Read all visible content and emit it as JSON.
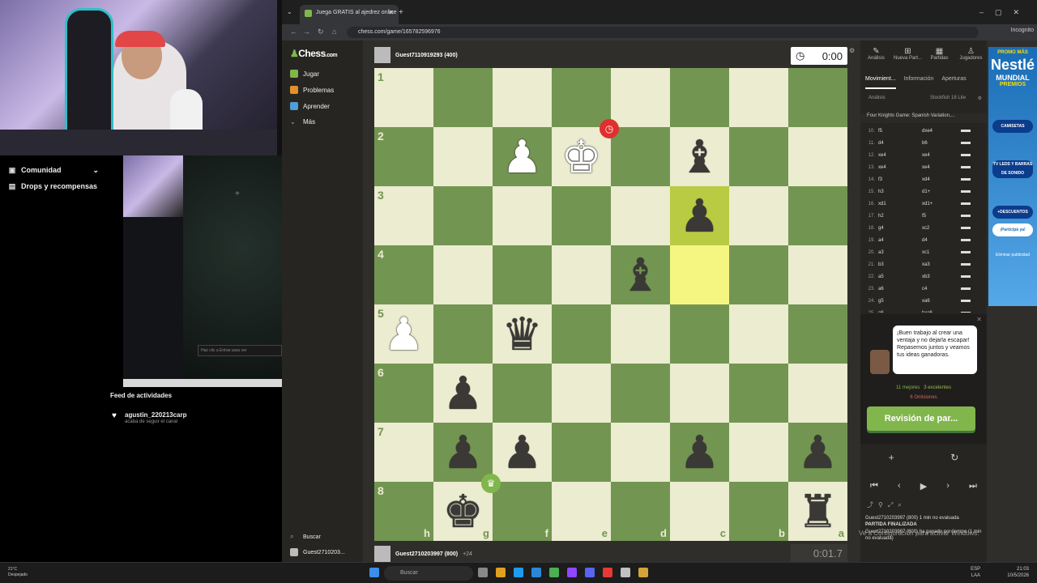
{
  "stream": {
    "sidebar": [
      {
        "icon": "camera-icon",
        "label": "Comunidad"
      },
      {
        "icon": "gift-icon",
        "label": "Drops y recompensas"
      }
    ],
    "preview_chat": "Haz clic a Entrar para ver",
    "feed_title": "Feed de actividades",
    "feed_user": "agustin_220213carp",
    "feed_action": "acaba de seguir el canal"
  },
  "browser": {
    "tab_title": "Juega GRATIS al ajedrez online",
    "url": "chess.com/game/165782596976",
    "incognito": "Incognito",
    "search_label": "Buscar",
    "user_label": "Guest2710203..."
  },
  "chess": {
    "logo_a": "Chess",
    "logo_b": ".com",
    "nav": [
      {
        "label": "Jugar",
        "color": "#81b64c"
      },
      {
        "label": "Problemas",
        "color": "#e58f2a"
      },
      {
        "label": "Aprender",
        "color": "#4f9fd6"
      },
      {
        "label": "Más",
        "color": "#888"
      }
    ],
    "top_player": "Guest7110919293 (400)",
    "bottom_player": "Guest2710203997 (800)",
    "bottom_extra": "+24",
    "clock_top": "0:00",
    "clock_bottom": "0:01.7",
    "ranks": [
      "1",
      "2",
      "3",
      "4",
      "5",
      "6",
      "7",
      "8"
    ],
    "files": [
      "h",
      "g",
      "f",
      "e",
      "d",
      "c",
      "b",
      "a"
    ]
  },
  "panel": {
    "tabs": [
      "Análisis",
      "Nueva Part...",
      "Partidas",
      "Jugadores"
    ],
    "subtabs": [
      "Movimient...",
      "Información",
      "Aperturas"
    ],
    "engine_label": "Análisis",
    "engine_name": "Stockfish 18 Lite",
    "opening": "Four Knights Game: Spanish Variation,...",
    "moves": [
      {
        "n": "10.",
        "w": "f5",
        "b": "dxe4"
      },
      {
        "n": "11.",
        "w": "d4",
        "b": "b6"
      },
      {
        "n": "12.",
        "w": "xe4",
        "b": "xe4"
      },
      {
        "n": "13.",
        "w": "xe4",
        "b": "xe4"
      },
      {
        "n": "14.",
        "w": "f3",
        "b": "xd4"
      },
      {
        "n": "15.",
        "w": "h3",
        "b": "d1+"
      },
      {
        "n": "16.",
        "w": "xd1",
        "b": "xd1+"
      },
      {
        "n": "17.",
        "w": "h2",
        "b": "f5"
      },
      {
        "n": "18.",
        "w": "g4",
        "b": "xc2"
      },
      {
        "n": "19.",
        "w": "a4",
        "b": "d4"
      },
      {
        "n": "20.",
        "w": "a3",
        "b": "xc1"
      },
      {
        "n": "21.",
        "w": "b3",
        "b": "xa3"
      },
      {
        "n": "22.",
        "w": "a5",
        "b": "xb3"
      },
      {
        "n": "23.",
        "w": "a6",
        "b": "c4"
      },
      {
        "n": "24.",
        "w": "g5",
        "b": "xa6"
      },
      {
        "n": "25.",
        "w": "g6",
        "b": "hxg6"
      }
    ],
    "coach_text": "¡Buen trabajo al crear una ventaja y no dejarla escapar! Repasemos juntos y veamos tus ideas ganadoras.",
    "stat_best": "11 mejores",
    "stat_excellent": "3 excelentes",
    "stat_omissions": "6 Omisiones",
    "review_btn": "Revisión de par...",
    "log": [
      "Guest2710203997 (800) 1 min no evaluada",
      "PARTIDA FINALIZADA",
      "Guest2710203997 (800) ha ganado por tiempo (1 min no evaluada)"
    ]
  },
  "ad": {
    "promo": "PROMO MÁS",
    "brand": "Nestlé",
    "mundial": "MUNDIAL",
    "premios": "PREMIOS",
    "items": [
      "CAMISETAS",
      "TV LEDS Y BARRAS DE SONIDO",
      "+DESCUENTOS"
    ],
    "cta": "¡Participá ya!",
    "remove": "Eliminar publicidad"
  },
  "watermark": "Ve a Configuración para activar Windows.",
  "taskbar": {
    "temp": "21°C",
    "weather": "Despejado",
    "search": "Buscar",
    "lang": "ESP LAA",
    "time": "21:03",
    "date": "10/5/2026"
  }
}
